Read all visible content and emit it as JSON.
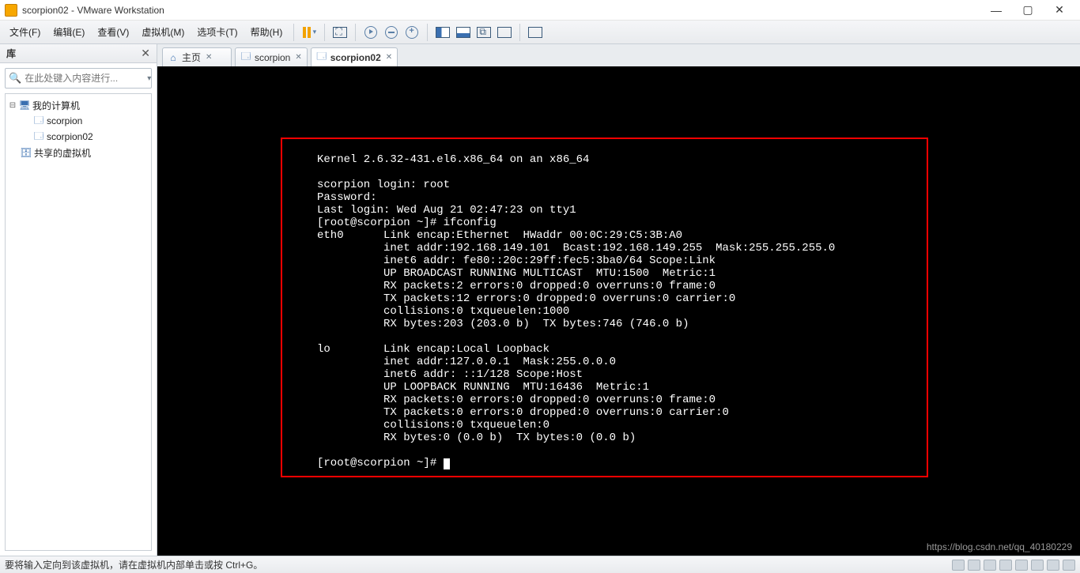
{
  "window": {
    "title": "scorpion02 - VMware Workstation"
  },
  "menu": {
    "items": [
      "文件(F)",
      "编辑(E)",
      "查看(V)",
      "虚拟机(M)",
      "选项卡(T)",
      "帮助(H)"
    ]
  },
  "sidebar": {
    "header": "库",
    "search_placeholder": "在此处键入内容进行...",
    "nodes": {
      "root": "我的计算机",
      "vm1": "scorpion",
      "vm2": "scorpion02",
      "shared": "共享的虚拟机"
    }
  },
  "tabs": [
    {
      "label": "主页",
      "kind": "home"
    },
    {
      "label": "scorpion",
      "kind": "vm"
    },
    {
      "label": "scorpion02",
      "kind": "vm",
      "active": true
    }
  ],
  "console_lines": [
    "Kernel 2.6.32-431.el6.x86_64 on an x86_64",
    "",
    "scorpion login: root",
    "Password:",
    "Last login: Wed Aug 21 02:47:23 on tty1",
    "[root@scorpion ~]# ifconfig",
    "eth0      Link encap:Ethernet  HWaddr 00:0C:29:C5:3B:A0",
    "          inet addr:192.168.149.101  Bcast:192.168.149.255  Mask:255.255.255.0",
    "          inet6 addr: fe80::20c:29ff:fec5:3ba0/64 Scope:Link",
    "          UP BROADCAST RUNNING MULTICAST  MTU:1500  Metric:1",
    "          RX packets:2 errors:0 dropped:0 overruns:0 frame:0",
    "          TX packets:12 errors:0 dropped:0 overruns:0 carrier:0",
    "          collisions:0 txqueuelen:1000",
    "          RX bytes:203 (203.0 b)  TX bytes:746 (746.0 b)",
    "",
    "lo        Link encap:Local Loopback",
    "          inet addr:127.0.0.1  Mask:255.0.0.0",
    "          inet6 addr: ::1/128 Scope:Host",
    "          UP LOOPBACK RUNNING  MTU:16436  Metric:1",
    "          RX packets:0 errors:0 dropped:0 overruns:0 frame:0",
    "          TX packets:0 errors:0 dropped:0 overruns:0 carrier:0",
    "          collisions:0 txqueuelen:0",
    "          RX bytes:0 (0.0 b)  TX bytes:0 (0.0 b)",
    "",
    "[root@scorpion ~]# "
  ],
  "statusbar": {
    "message": "要将输入定向到该虚拟机，请在虚拟机内部单击或按 Ctrl+G。"
  },
  "watermark": "https://blog.csdn.net/qq_40180229"
}
